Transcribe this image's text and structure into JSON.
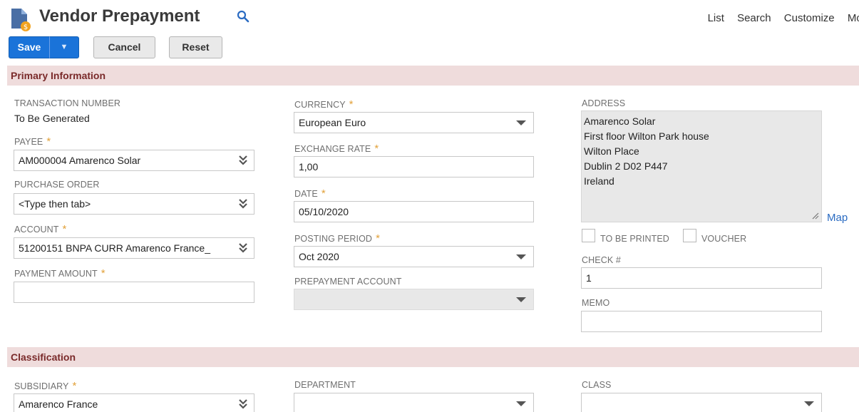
{
  "header": {
    "title": "Vendor Prepayment",
    "links": [
      "List",
      "Search",
      "Customize",
      "More"
    ]
  },
  "toolbar": {
    "save_label": "Save",
    "save_menu_glyph": "▼",
    "cancel_label": "Cancel",
    "reset_label": "Reset"
  },
  "sections": {
    "primary": "Primary Information",
    "classification": "Classification"
  },
  "primary": {
    "transaction_number": {
      "label": "TRANSACTION NUMBER",
      "value": "To Be Generated"
    },
    "payee": {
      "label": "PAYEE",
      "value": "AM000004 Amarenco Solar"
    },
    "purchase_order": {
      "label": "PURCHASE ORDER",
      "value": "<Type then tab>"
    },
    "account": {
      "label": "ACCOUNT",
      "value": "51200151 BNPA CURR Amarenco France_"
    },
    "payment_amount": {
      "label": "PAYMENT AMOUNT",
      "value": ""
    },
    "currency": {
      "label": "CURRENCY",
      "value": "European Euro"
    },
    "exchange_rate": {
      "label": "EXCHANGE RATE",
      "value": "1,00"
    },
    "date": {
      "label": "DATE",
      "value": "05/10/2020"
    },
    "posting_period": {
      "label": "POSTING PERIOD",
      "value": "Oct 2020"
    },
    "prepayment_account": {
      "label": "PREPAYMENT ACCOUNT",
      "value": ""
    },
    "address": {
      "label": "ADDRESS",
      "lines": [
        "Amarenco Solar",
        "First floor Wilton Park house",
        "Wilton Place",
        "Dublin 2  D02 P447",
        "Ireland"
      ],
      "map_link": "Map"
    },
    "to_be_printed": {
      "label": "TO BE PRINTED",
      "checked": false
    },
    "voucher": {
      "label": "VOUCHER",
      "checked": false
    },
    "check_number": {
      "label": "CHECK #",
      "value": "1"
    },
    "memo": {
      "label": "MEMO",
      "value": ""
    }
  },
  "classification": {
    "subsidiary": {
      "label": "SUBSIDIARY",
      "value": "Amarenco France"
    },
    "department": {
      "label": "DEPARTMENT",
      "value": ""
    },
    "class": {
      "label": "CLASS",
      "value": ""
    }
  },
  "required_marker": "*",
  "colors": {
    "accent": "#1a73d9",
    "section_bar": "#efdcdc",
    "section_text": "#7a2a2a",
    "required": "#e2a23b",
    "link": "#2a6bc2"
  }
}
